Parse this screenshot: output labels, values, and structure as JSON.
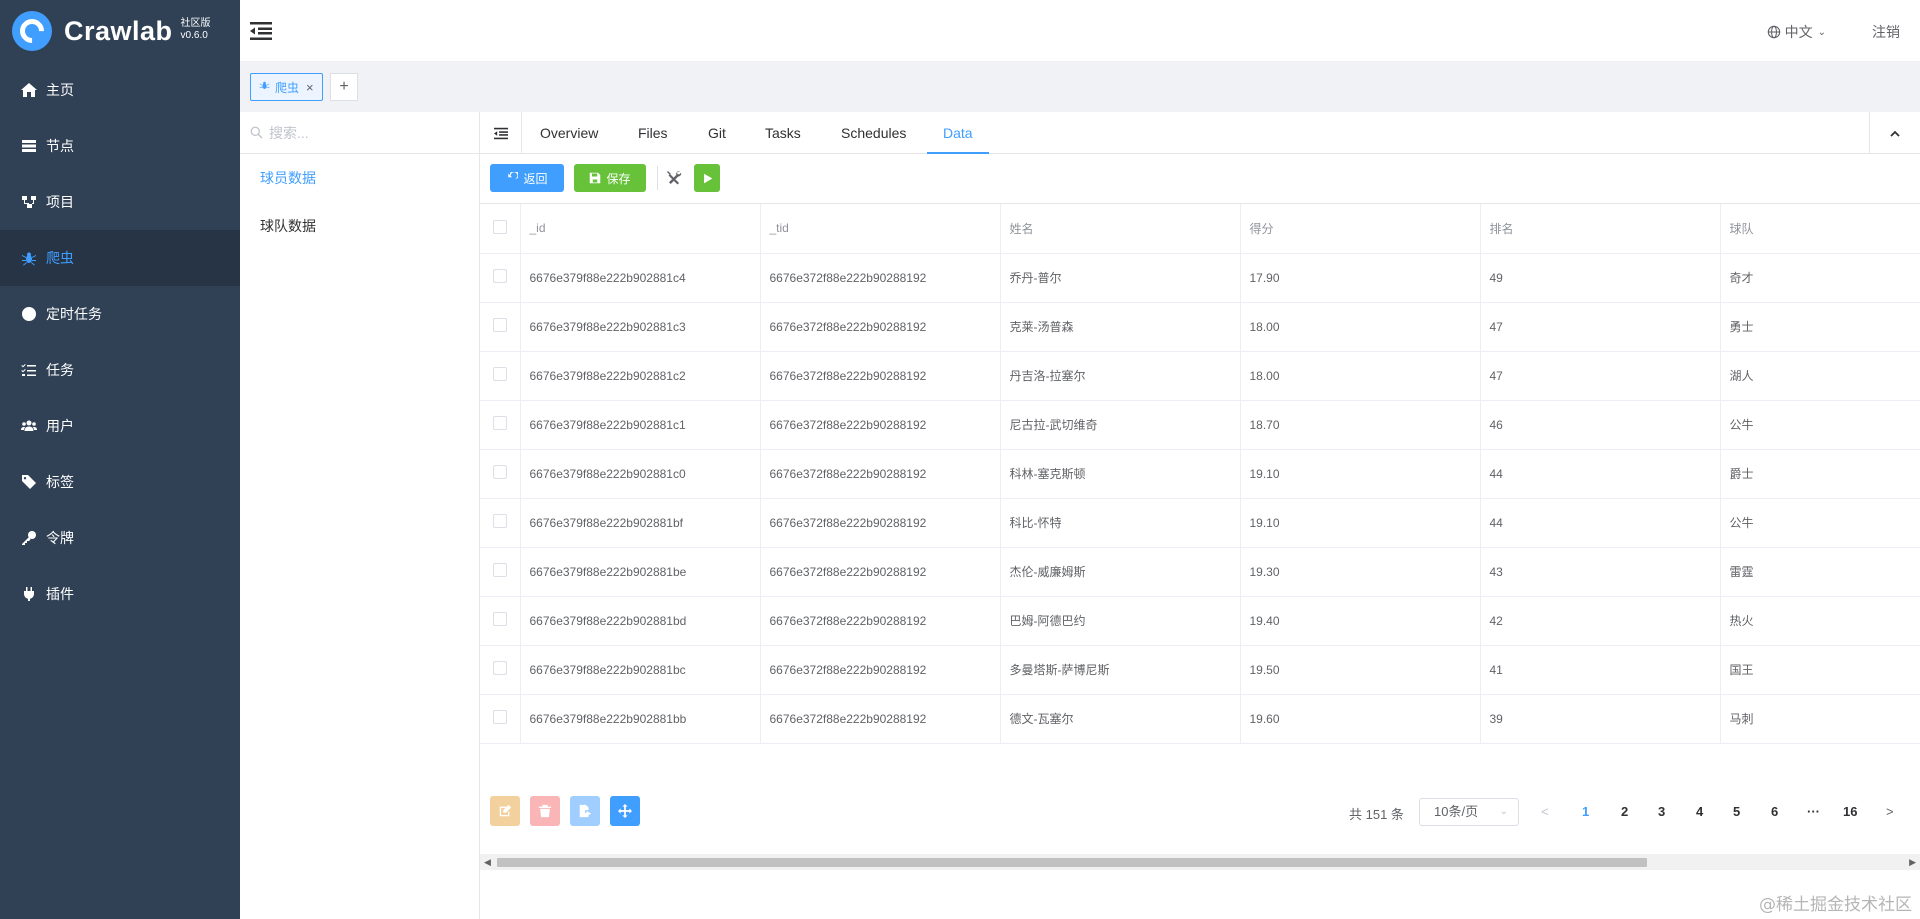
{
  "app": {
    "name": "Crawlab",
    "edition": "社区版",
    "version": "v0.6.0"
  },
  "sidebar": {
    "items": [
      {
        "label": "主页",
        "icon": "home-icon"
      },
      {
        "label": "节点",
        "icon": "server-icon"
      },
      {
        "label": "项目",
        "icon": "project-icon"
      },
      {
        "label": "爬虫",
        "icon": "spider-icon",
        "active": true
      },
      {
        "label": "定时任务",
        "icon": "clock-icon"
      },
      {
        "label": "任务",
        "icon": "task-list-icon"
      },
      {
        "label": "用户",
        "icon": "users-icon"
      },
      {
        "label": "标签",
        "icon": "tag-icon"
      },
      {
        "label": "令牌",
        "icon": "key-icon"
      },
      {
        "label": "插件",
        "icon": "plug-icon"
      }
    ]
  },
  "header": {
    "language": "中文",
    "logout": "注销"
  },
  "page_tabs": [
    {
      "label": "爬虫"
    }
  ],
  "side_list": {
    "search_placeholder": "搜索...",
    "items": [
      {
        "label": "球员数据",
        "active": true
      },
      {
        "label": "球队数据"
      }
    ]
  },
  "detail_tabs": [
    "Overview",
    "Files",
    "Git",
    "Tasks",
    "Schedules",
    "Data"
  ],
  "active_tab": "Data",
  "toolbar": {
    "back_label": "返回",
    "save_label": "保存"
  },
  "table": {
    "columns": [
      "_id",
      "_tid",
      "姓名",
      "得分",
      "排名",
      "球队"
    ],
    "rows": [
      [
        "6676e379f88e222b902881c4",
        "6676e372f88e222b90288192",
        "乔丹-普尔",
        "17.90",
        "49",
        "奇才"
      ],
      [
        "6676e379f88e222b902881c3",
        "6676e372f88e222b90288192",
        "克莱-汤普森",
        "18.00",
        "47",
        "勇士"
      ],
      [
        "6676e379f88e222b902881c2",
        "6676e372f88e222b90288192",
        "丹吉洛-拉塞尔",
        "18.00",
        "47",
        "湖人"
      ],
      [
        "6676e379f88e222b902881c1",
        "6676e372f88e222b90288192",
        "尼古拉-武切维奇",
        "18.70",
        "46",
        "公牛"
      ],
      [
        "6676e379f88e222b902881c0",
        "6676e372f88e222b90288192",
        "科林-塞克斯顿",
        "19.10",
        "44",
        "爵士"
      ],
      [
        "6676e379f88e222b902881bf",
        "6676e372f88e222b90288192",
        "科比-怀特",
        "19.10",
        "44",
        "公牛"
      ],
      [
        "6676e379f88e222b902881be",
        "6676e372f88e222b90288192",
        "杰伦-威廉姆斯",
        "19.30",
        "43",
        "雷霆"
      ],
      [
        "6676e379f88e222b902881bd",
        "6676e372f88e222b90288192",
        "巴姆-阿德巴约",
        "19.40",
        "42",
        "热火"
      ],
      [
        "6676e379f88e222b902881bc",
        "6676e372f88e222b90288192",
        "多曼塔斯-萨博尼斯",
        "19.50",
        "41",
        "国王"
      ],
      [
        "6676e379f88e222b902881bb",
        "6676e372f88e222b90288192",
        "德文-瓦塞尔",
        "19.60",
        "39",
        "马刺"
      ]
    ]
  },
  "pagination": {
    "total_text": "共 151 条",
    "page_size": "10条/页",
    "pages": [
      "1",
      "2",
      "3",
      "4",
      "5",
      "6",
      "16"
    ],
    "current": "1"
  },
  "watermark": "@稀土掘金技术社区",
  "colors": {
    "primary": "#409eff",
    "success": "#67c23a",
    "sidebar_bg": "#304156",
    "warning_light": "#f3d19e",
    "danger_light": "#fab6b6",
    "primary_light": "#a0cfff"
  }
}
